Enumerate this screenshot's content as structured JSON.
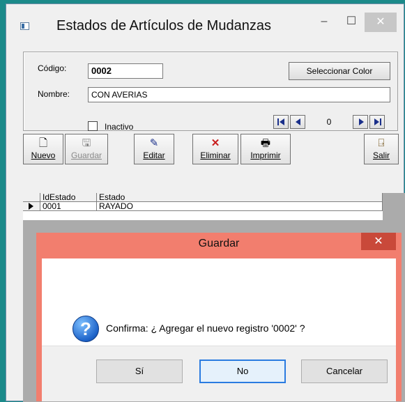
{
  "window": {
    "title": "Estados de Artículos de Mudanzas",
    "minimize": "–",
    "maximize": "☐",
    "close": "✕"
  },
  "form": {
    "codigo_label": "Código:",
    "codigo_value": "0002",
    "nombre_label": "Nombre:",
    "nombre_value": "CON AVERIAS",
    "color_button": "Seleccionar Color",
    "inactivo_label": "Inactivo",
    "record_position": "0"
  },
  "toolbar": {
    "nuevo": "Nuevo",
    "guardar": "Guardar",
    "editar": "Editar",
    "eliminar": "Eliminar",
    "imprimir": "Imprimir",
    "salir": "Salir"
  },
  "grid": {
    "columns": [
      "IdEstado",
      "Estado"
    ],
    "rows": [
      [
        "0001",
        "RAYADO"
      ]
    ]
  },
  "dialog": {
    "title": "Guardar",
    "close": "✕",
    "message": "Confirma: ¿ Agregar el nuevo registro '0002' ?",
    "icon": "question-icon",
    "buttons": {
      "si": "Sí",
      "no": "No",
      "cancelar": "Cancelar"
    }
  }
}
